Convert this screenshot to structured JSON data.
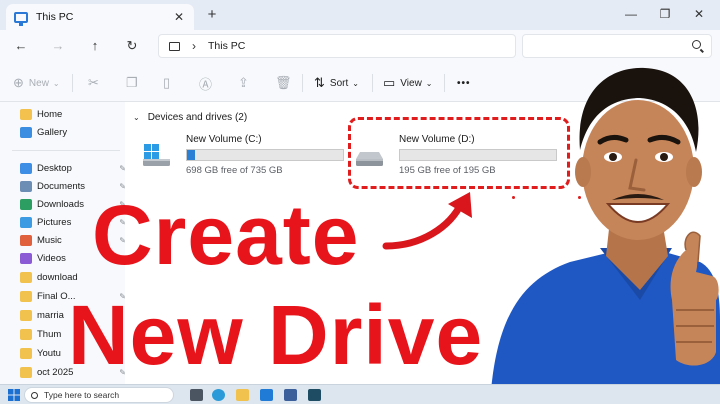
{
  "window": {
    "tab_title": "This PC",
    "new_tab": "+",
    "tab_close": "✕",
    "controls": {
      "minimize": "—",
      "maximize": "❐",
      "close": "✕"
    }
  },
  "address": {
    "back": "←",
    "forward": "→",
    "up": "↑",
    "refresh": "↻",
    "separator": "›",
    "breadcrumb": "This PC"
  },
  "commands": {
    "new_label": "New",
    "sort_label": "Sort",
    "view_label": "View",
    "more": "•••",
    "chevron": "⌄"
  },
  "sidebar": {
    "items": [
      {
        "label": "Home",
        "icon": "home-icon"
      },
      {
        "label": "Gallery",
        "icon": "gallery-icon"
      },
      {
        "label": "Desktop",
        "icon": "desktop-icon",
        "pinned": true
      },
      {
        "label": "Documents",
        "icon": "documents-icon",
        "pinned": true
      },
      {
        "label": "Downloads",
        "icon": "downloads-icon",
        "pinned": true
      },
      {
        "label": "Pictures",
        "icon": "pictures-icon",
        "pinned": true
      },
      {
        "label": "Music",
        "icon": "music-icon",
        "pinned": true
      },
      {
        "label": "Videos",
        "icon": "videos-icon",
        "pinned": true
      },
      {
        "label": "download",
        "icon": "folder-icon"
      },
      {
        "label": "Final O...",
        "icon": "folder-icon",
        "pinned": true
      },
      {
        "label": "marria",
        "icon": "folder-icon"
      },
      {
        "label": "Thum",
        "icon": "folder-icon"
      },
      {
        "label": "Youtu",
        "icon": "folder-icon"
      },
      {
        "label": "oct 2025",
        "icon": "folder-icon",
        "pinned": true
      }
    ],
    "pin_glyph": "📌"
  },
  "content": {
    "group_label": "Devices and drives (2)",
    "group_chevron": "⌄",
    "drives": [
      {
        "name": "New Volume (C:)",
        "free_text": "698 GB free of 735 GB",
        "used_fraction": 0.05
      },
      {
        "name": "New Volume (D:)",
        "free_text": "195 GB free of 195 GB",
        "used_fraction": 0.0
      }
    ]
  },
  "overlay": {
    "line1": "Create",
    "line2": "New Drive"
  },
  "taskbar": {
    "search_placeholder": "Type here to search"
  },
  "colors": {
    "accent": "#2b7fd4",
    "highlight": "#e01c1c",
    "overlay_text": "#e8141b",
    "shirt": "#1f57c3"
  }
}
